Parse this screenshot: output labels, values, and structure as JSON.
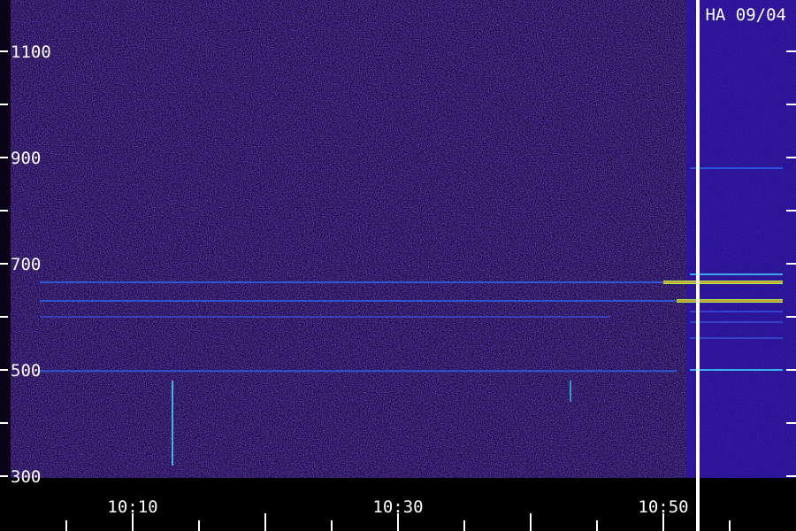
{
  "chart_data": {
    "type": "heatmap",
    "title": "HA 09/04",
    "xlabel": "",
    "ylabel": "",
    "y_ticks": [
      300,
      500,
      700,
      900,
      1100
    ],
    "y_range": [
      300,
      1180
    ],
    "x_ticks": [
      "10:10",
      "10:30",
      "10:50"
    ],
    "x_range": [
      "10:01",
      "10:58"
    ],
    "marker_time": "10:53",
    "bands": [
      {
        "freq": 665,
        "from": "10:03",
        "to": "10:49",
        "level": 0.55
      },
      {
        "freq": 630,
        "from": "10:03",
        "to": "10:50",
        "level": 0.45
      },
      {
        "freq": 600,
        "from": "10:03",
        "to": "10:45",
        "level": 0.28
      },
      {
        "freq": 498,
        "from": "10:03",
        "to": "10:50",
        "level": 0.5
      },
      {
        "freq": 880,
        "from": "10:52",
        "to": "10:58",
        "level": 0.5
      },
      {
        "freq": 680,
        "from": "10:52",
        "to": "10:58",
        "level": 0.65
      },
      {
        "freq": 665,
        "from": "10:50",
        "to": "10:58",
        "level": 0.95
      },
      {
        "freq": 630,
        "from": "10:51",
        "to": "10:58",
        "level": 0.9
      },
      {
        "freq": 610,
        "from": "10:52",
        "to": "10:58",
        "level": 0.4
      },
      {
        "freq": 590,
        "from": "10:52",
        "to": "10:58",
        "level": 0.35
      },
      {
        "freq": 560,
        "from": "10:52",
        "to": "10:58",
        "level": 0.35
      },
      {
        "freq": 500,
        "from": "10:52",
        "to": "10:58",
        "level": 0.7
      }
    ],
    "bursts": [
      {
        "time": "10:13",
        "freq_low": 320,
        "freq_high": 480,
        "level": 0.45
      },
      {
        "time": "10:43",
        "freq_low": 440,
        "freq_high": 480,
        "level": 0.25
      }
    ],
    "colors": {
      "background": "#1a0c3e",
      "low": "#3010a0",
      "mid": "#2a6cff",
      "high": "#a8ff40",
      "peak": "#ff3030",
      "axis": "#ffffff"
    }
  }
}
